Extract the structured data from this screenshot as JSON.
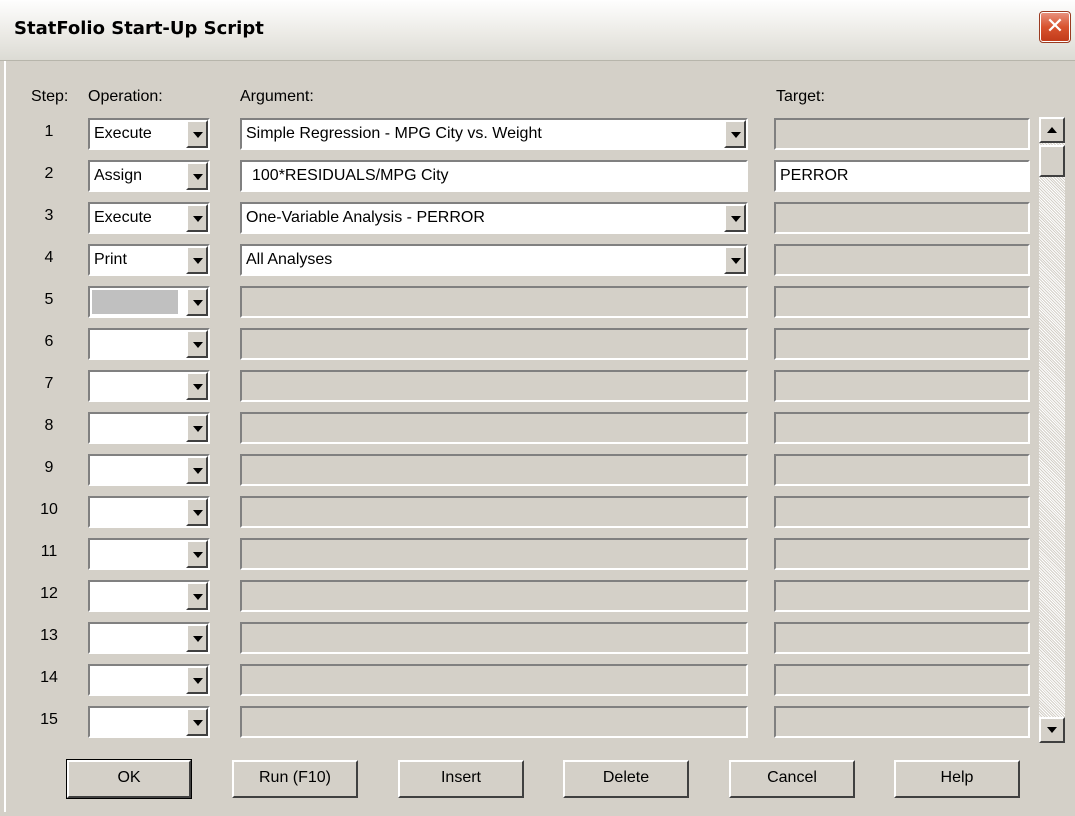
{
  "window": {
    "title": "StatFolio Start-Up Script",
    "close_glyph": "✕"
  },
  "headers": {
    "step": "Step:",
    "operation": "Operation:",
    "argument": "Argument:",
    "target": "Target:"
  },
  "rows": [
    {
      "step": "1",
      "operation": "Execute",
      "argument": "Simple Regression - MPG City vs. Weight",
      "argument_type": "dropdown",
      "target": ""
    },
    {
      "step": "2",
      "operation": "Assign",
      "argument": "100*RESIDUALS/MPG City",
      "argument_type": "text",
      "target": "PERROR"
    },
    {
      "step": "3",
      "operation": "Execute",
      "argument": "One-Variable Analysis - PERROR",
      "argument_type": "dropdown",
      "target": ""
    },
    {
      "step": "4",
      "operation": "Print",
      "argument": "All Analyses",
      "argument_type": "dropdown",
      "target": ""
    },
    {
      "step": "5",
      "operation": "",
      "argument": "",
      "argument_type": "empty",
      "target": "",
      "selected": true
    },
    {
      "step": "6",
      "operation": "",
      "argument": "",
      "argument_type": "empty",
      "target": ""
    },
    {
      "step": "7",
      "operation": "",
      "argument": "",
      "argument_type": "empty",
      "target": ""
    },
    {
      "step": "8",
      "operation": "",
      "argument": "",
      "argument_type": "empty",
      "target": ""
    },
    {
      "step": "9",
      "operation": "",
      "argument": "",
      "argument_type": "empty",
      "target": ""
    },
    {
      "step": "10",
      "operation": "",
      "argument": "",
      "argument_type": "empty",
      "target": ""
    },
    {
      "step": "11",
      "operation": "",
      "argument": "",
      "argument_type": "empty",
      "target": ""
    },
    {
      "step": "12",
      "operation": "",
      "argument": "",
      "argument_type": "empty",
      "target": ""
    },
    {
      "step": "13",
      "operation": "",
      "argument": "",
      "argument_type": "empty",
      "target": ""
    },
    {
      "step": "14",
      "operation": "",
      "argument": "",
      "argument_type": "empty",
      "target": ""
    },
    {
      "step": "15",
      "operation": "",
      "argument": "",
      "argument_type": "empty",
      "target": ""
    }
  ],
  "buttons": {
    "ok": "OK",
    "run": "Run (F10)",
    "insert": "Insert",
    "delete": "Delete",
    "cancel": "Cancel",
    "help": "Help"
  },
  "icons": {
    "close": "close-icon",
    "dropdown": "chevron-down-icon",
    "scroll_up": "scroll-up-icon",
    "scroll_down": "scroll-down-icon"
  },
  "colors": {
    "dialog_bg": "#d4d0c8",
    "close_red": "#d8532f",
    "field_white": "#ffffff"
  }
}
